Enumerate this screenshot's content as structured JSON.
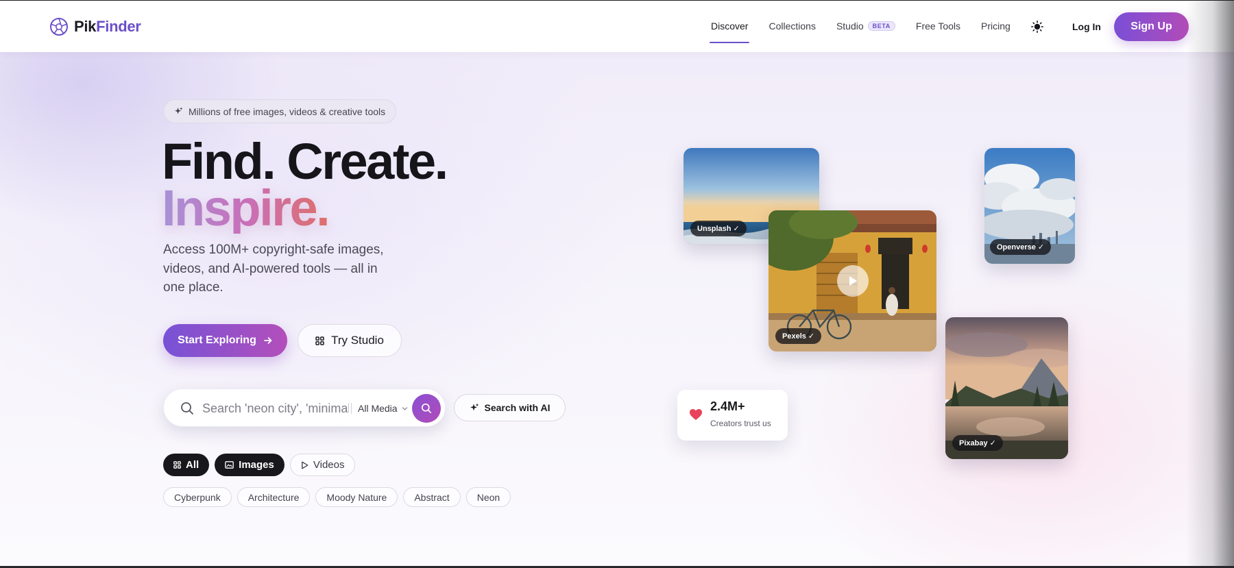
{
  "brand": {
    "name_part1": "Pik",
    "name_part2": "Finder",
    "logo_icon": "aperture-icon",
    "accent": "#6a4fc9"
  },
  "nav": {
    "links": [
      {
        "label": "Discover",
        "active": true
      },
      {
        "label": "Collections"
      },
      {
        "label": "Studio",
        "badge": "BETA"
      },
      {
        "label": "Free Tools"
      },
      {
        "label": "Pricing"
      }
    ],
    "theme_icon": "sun-icon",
    "login": "Log In",
    "signup": "Sign Up"
  },
  "hero": {
    "pill": "Millions of free images, videos & creative tools",
    "headline_line1": "Find. Create.",
    "headline_line2": "Inspire.",
    "description": "Access 100M+ copyright-safe images, videos, and AI-powered tools — all in one place.",
    "primary_cta": "Start Exploring",
    "secondary_cta": "Try Studio"
  },
  "search": {
    "placeholder": "Search 'neon city', 'minimalist desk'...",
    "media_select": "All Media",
    "ai_button": "Search with AI"
  },
  "filters": [
    {
      "label": "All",
      "icon": "grid-icon",
      "style": "dark"
    },
    {
      "label": "Images",
      "icon": "image-icon",
      "style": "dark"
    },
    {
      "label": "Videos",
      "icon": "play-icon",
      "style": "light"
    }
  ],
  "tags": [
    "Cyberpunk",
    "Architecture",
    "Moody Nature",
    "Abstract",
    "Neon"
  ],
  "cards": {
    "unsplash": "Unsplash",
    "pexels": "Pexels",
    "openverse": "Openverse",
    "pixabay": "Pixabay",
    "check": "✓"
  },
  "stat": {
    "value": "2.4M+",
    "label": "Creators trust us",
    "icon": "heart-icon",
    "icon_color": "#e8435a"
  }
}
